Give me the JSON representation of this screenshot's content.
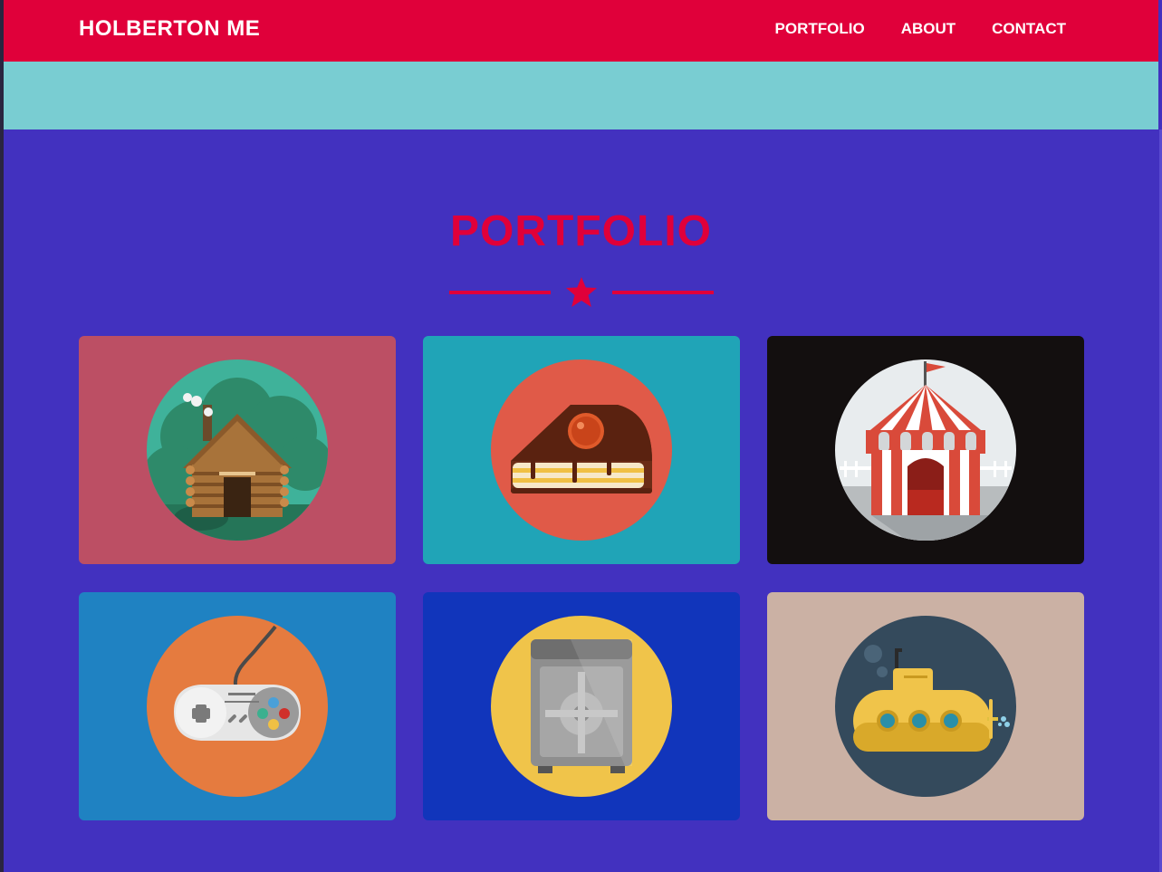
{
  "navbar": {
    "brand": "HOLBERTON ME",
    "links": [
      "PORTFOLIO",
      "ABOUT",
      "CONTACT"
    ]
  },
  "portfolio": {
    "title": "PORTFOLIO",
    "divider_icon": "star-icon",
    "items": [
      {
        "icon": "log-cabin-icon",
        "bg": "#bc4f64",
        "circle": "#3fb29a"
      },
      {
        "icon": "cake-slice-icon",
        "bg": "#20a4b7",
        "circle": "#e05a48"
      },
      {
        "icon": "circus-tent-icon",
        "bg": "#130f0f",
        "circle": "#e8ecee"
      },
      {
        "icon": "game-controller-icon",
        "bg": "#1f82c2",
        "circle": "#e57b3f"
      },
      {
        "icon": "safe-icon",
        "bg": "#1135bb",
        "circle": "#f0c44a"
      },
      {
        "icon": "submarine-icon",
        "bg": "#cbb1a4",
        "circle": "#344a5c"
      }
    ]
  },
  "colors": {
    "accent": "#e0003a",
    "page_bg": "#4231bf",
    "hero_strip": "#79cdd2"
  }
}
